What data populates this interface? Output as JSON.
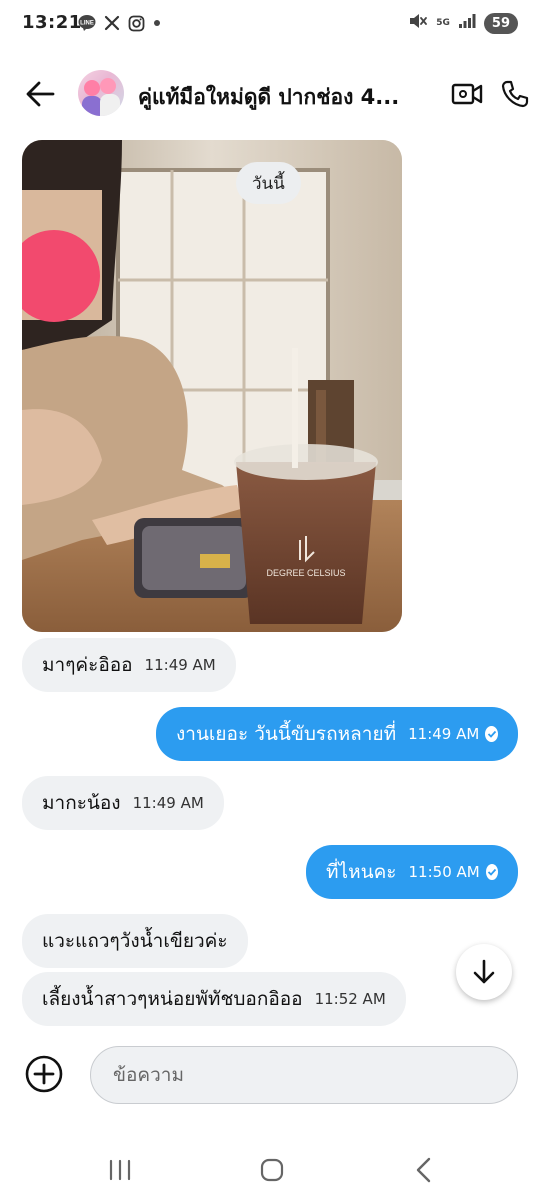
{
  "status_bar": {
    "time": "13:21",
    "network": "5G",
    "battery": "59",
    "left_icons": [
      "line-icon",
      "x-icon",
      "instagram-icon",
      "dot-icon"
    ],
    "right_icons": [
      "mute-icon",
      "signal-icon"
    ]
  },
  "header": {
    "title": "คู่แท้มือใหม่ดูดี ปากช่อง 4..."
  },
  "date_chip": "วันนี้",
  "messages": [
    {
      "direction": "in",
      "text": "มาๆค่ะอิออ",
      "time": "11:49 AM"
    },
    {
      "direction": "out",
      "text": "งานเยอะ วันนี้ขับรถหลายที่",
      "time": "11:49 AM"
    },
    {
      "direction": "in",
      "text": "มากะน้อง",
      "time": "11:49 AM"
    },
    {
      "direction": "out",
      "text": "ที่ไหนคะ",
      "time": "11:50 AM"
    },
    {
      "direction": "in",
      "text": "แวะแถวๆวังน้ำเขียวค่ะ",
      "time": ""
    },
    {
      "direction": "in",
      "text": "เลี้ยงน้ำสาวๆหน่อยพัทัชบอกอิออ",
      "time": "11:52 AM"
    }
  ],
  "composer": {
    "placeholder": "ข้อความ"
  },
  "colors": {
    "outgoing_bubble": "#2c9cf0",
    "incoming_bubble": "#eff1f3"
  }
}
